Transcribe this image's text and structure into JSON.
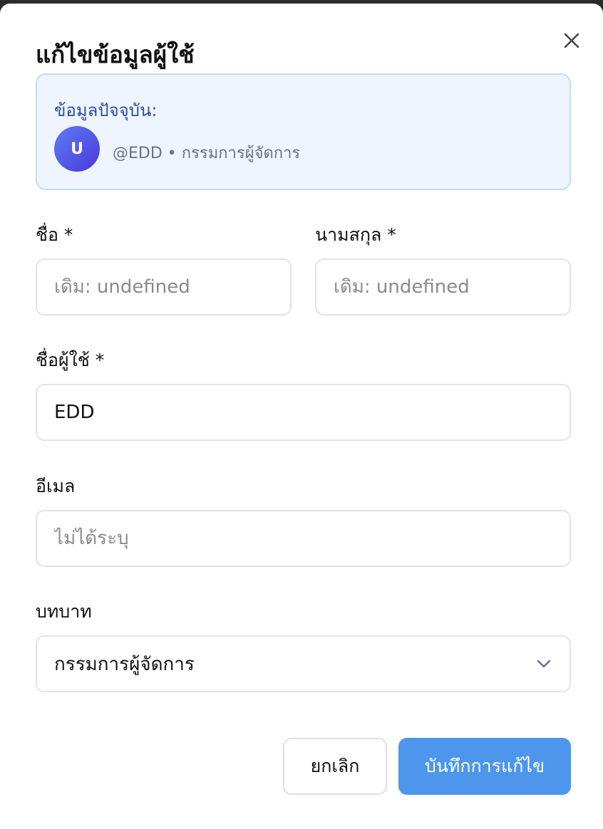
{
  "dialog": {
    "title": "แก้ไขข้อมูลผู้ใช้",
    "close_icon": "close-icon"
  },
  "current": {
    "label": "ข้อมูลปัจจุบัน:",
    "avatar_initial": "U",
    "meta": "@EDD • กรรมการผู้จัดการ",
    "avatar_colors": [
      "#5d7cf6",
      "#4a39d8"
    ]
  },
  "fields": {
    "first_name": {
      "label": "ชื่อ *",
      "placeholder": "เดิม: undefined",
      "value": ""
    },
    "last_name": {
      "label": "นามสกุล *",
      "placeholder": "เดิม: undefined",
      "value": ""
    },
    "username": {
      "label": "ชื่อผู้ใช้ *",
      "value": "EDD"
    },
    "email": {
      "label": "อีเมล",
      "placeholder": "ไม่ได้ระบุ",
      "value": ""
    },
    "role": {
      "label": "บทบาท",
      "selected": "กรรมการผู้จัดการ",
      "icon": "chevron-down-icon"
    }
  },
  "actions": {
    "cancel_label": "ยกเลิก",
    "save_label": "บันทึกการแก้ไข"
  },
  "colors": {
    "accent": "#4d96ec",
    "info_bg": "#eef5fe",
    "info_border": "#c3dcf3",
    "info_text": "#2e4aa8"
  }
}
